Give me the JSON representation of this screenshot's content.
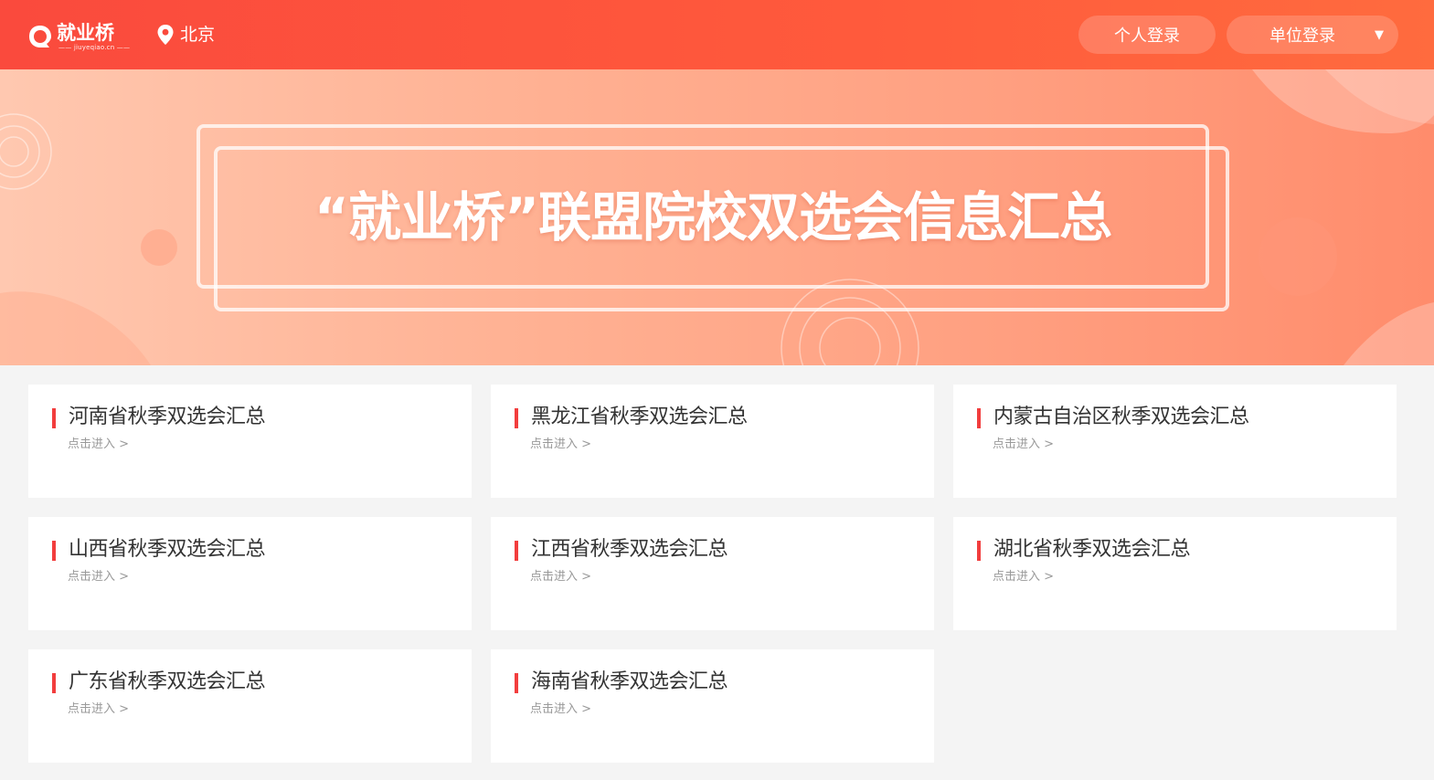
{
  "header": {
    "logo_text": "就业桥",
    "logo_sub": "—— jiuyeqiao.cn ——",
    "city": "北京",
    "personal_login": "个人登录",
    "unit_login": "单位登录",
    "unit_caret": "▼"
  },
  "banner": {
    "title": "“就业桥”联盟院校双选会信息汇总"
  },
  "cards": [
    {
      "title": "河南省秋季双选会汇总",
      "link": "点击进入 >"
    },
    {
      "title": "黑龙江省秋季双选会汇总",
      "link": "点击进入 >"
    },
    {
      "title": "内蒙古自治区秋季双选会汇总",
      "link": "点击进入 >"
    },
    {
      "title": "山西省秋季双选会汇总",
      "link": "点击进入 >"
    },
    {
      "title": "江西省秋季双选会汇总",
      "link": "点击进入 >"
    },
    {
      "title": "湖北省秋季双选会汇总",
      "link": "点击进入 >"
    },
    {
      "title": "广东省秋季双选会汇总",
      "link": "点击进入 >"
    },
    {
      "title": "海南省秋季双选会汇总",
      "link": "点击进入 >"
    }
  ],
  "colors": {
    "brand": "#fa4a3d",
    "accent_bar": "#f23d3d",
    "card_bg": "#ffffff",
    "page_bg": "#f4f4f4"
  },
  "icons": {
    "logo": "logo-icon",
    "location": "location-pin-icon",
    "caret": "caret-down-icon"
  }
}
